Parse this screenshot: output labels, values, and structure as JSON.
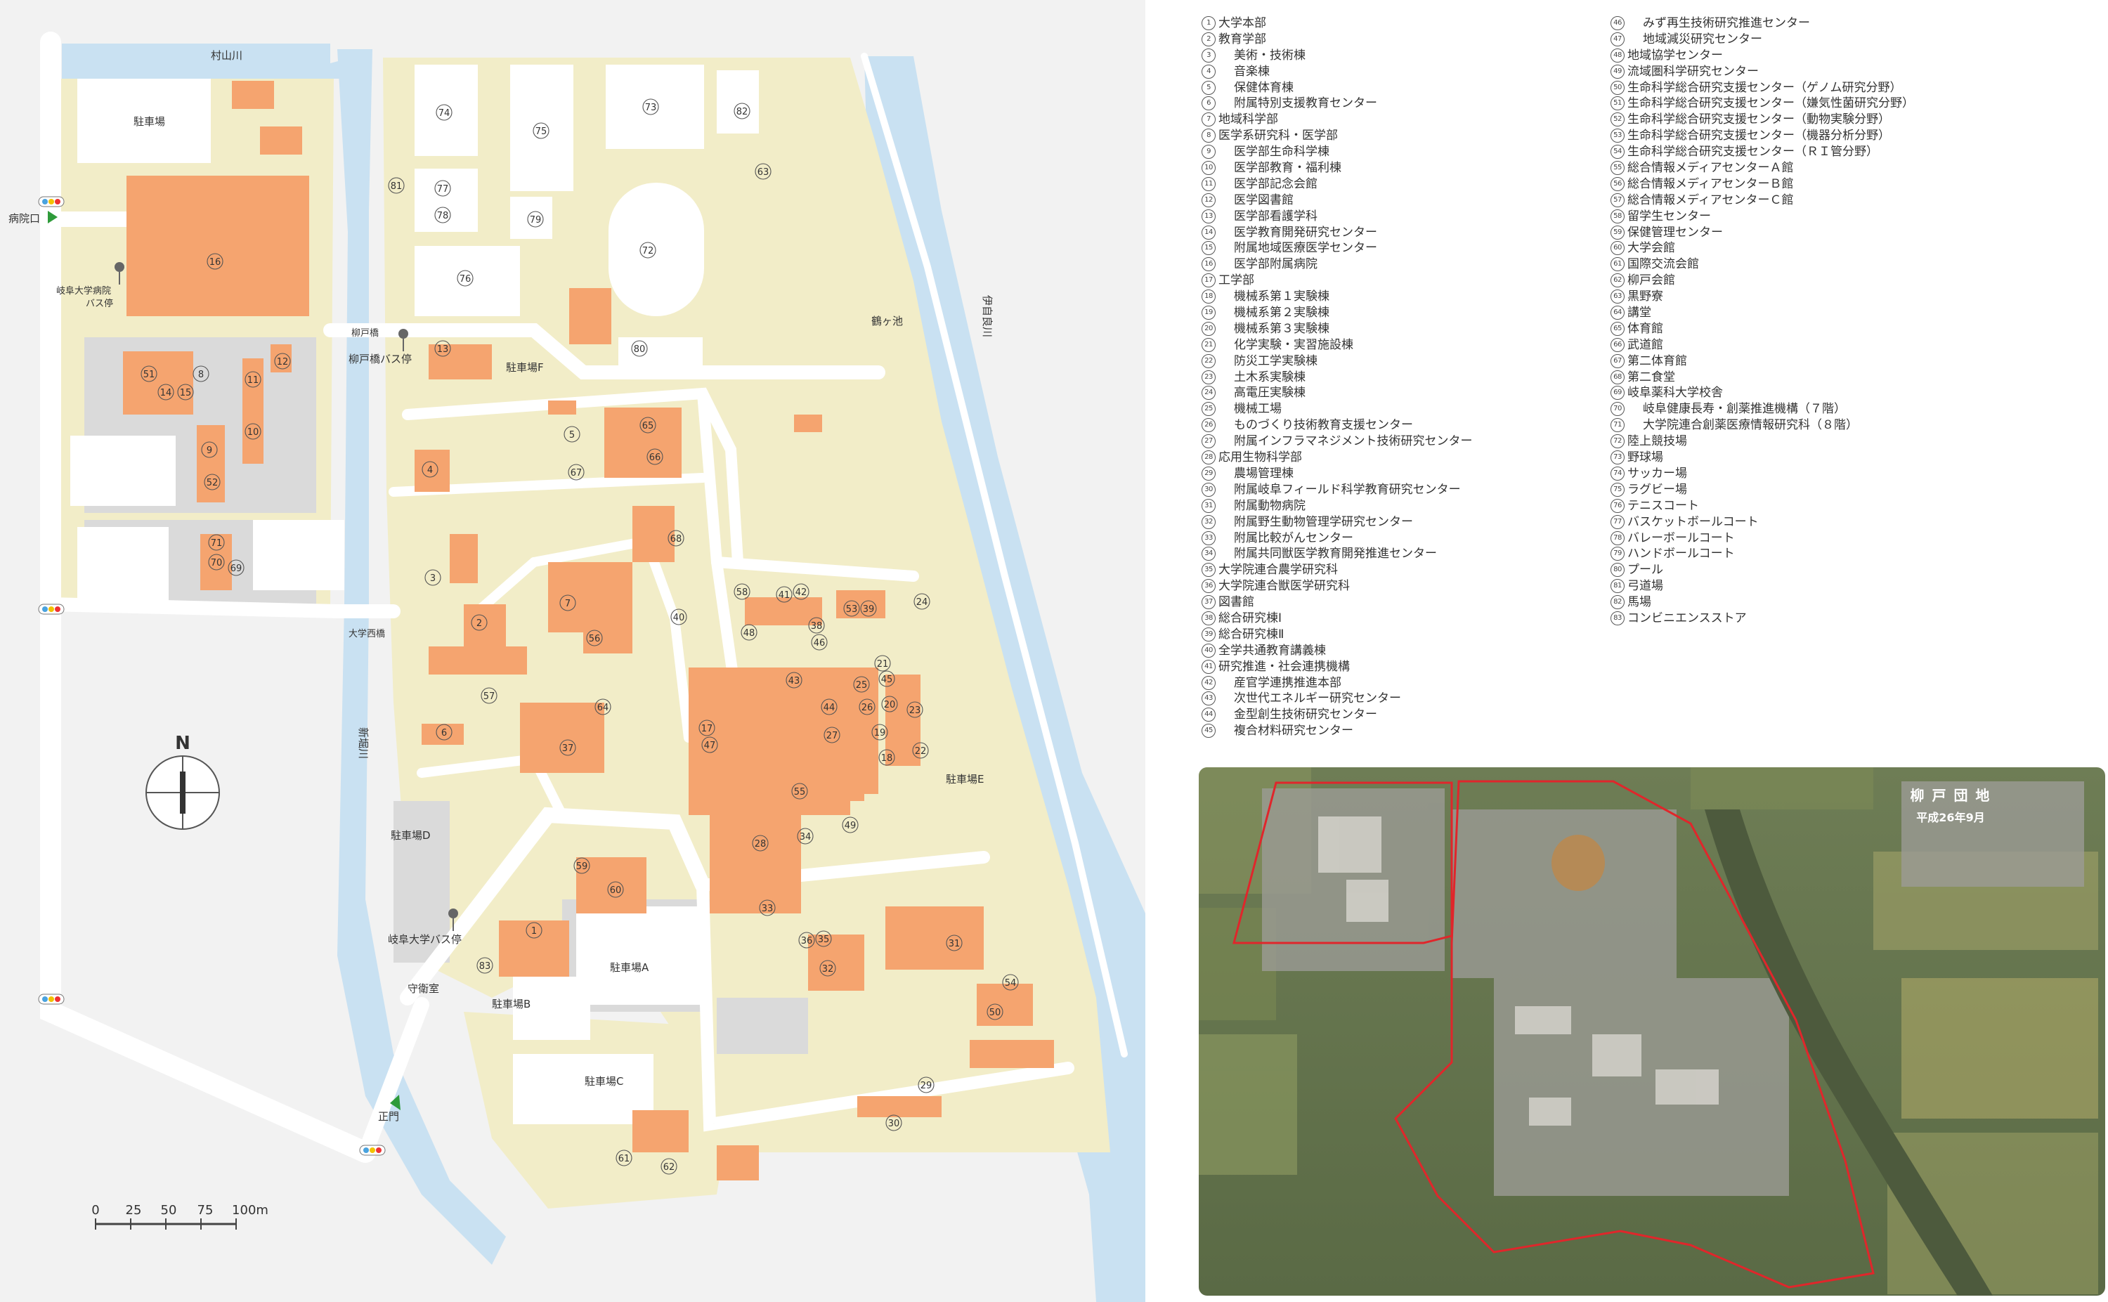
{
  "map": {
    "labels": {
      "murayama_river": "村山川",
      "parking_top": "駐車場",
      "hospital_gate": "病院口",
      "hospital_bus": "岐阜大学病院\nバス停",
      "yanagido_bridge": "柳戸橋",
      "yanagido_bus": "柳戸橋バス停",
      "parking_f": "駐車場F",
      "kakugaike": "鶴ヶ池",
      "ibi_river": "伊自良川",
      "west_bridge": "大学西橋",
      "shinbori_river": "新堀川",
      "parking_d": "駐車場D",
      "parking_e": "駐車場E",
      "gifu_univ_bus": "岐阜大学バス停",
      "guard_room": "守衛室",
      "parking_a": "駐車場A",
      "parking_b": "駐車場B",
      "parking_c": "駐車場C",
      "main_gate": "正門",
      "north": "N",
      "scale_ticks": [
        "0",
        "25",
        "50",
        "75",
        "100m"
      ]
    },
    "colors": {
      "campus": "#f2edc8",
      "building": "#f5a46f",
      "water": "#c9e1f2",
      "road": "#ffffff",
      "grey_block": "#dadada",
      "background": "#f2f2f2"
    }
  },
  "legend": {
    "col1": [
      {
        "n": "1",
        "name": "大学本部",
        "indent": false
      },
      {
        "n": "2",
        "name": "教育学部",
        "indent": false
      },
      {
        "n": "3",
        "name": "美術・技術棟",
        "indent": true
      },
      {
        "n": "4",
        "name": "音楽棟",
        "indent": true
      },
      {
        "n": "5",
        "name": "保健体育棟",
        "indent": true
      },
      {
        "n": "6",
        "name": "附属特別支援教育センター",
        "indent": true
      },
      {
        "n": "7",
        "name": "地域科学部",
        "indent": false
      },
      {
        "n": "8",
        "name": "医学系研究科・医学部",
        "indent": false
      },
      {
        "n": "9",
        "name": "医学部生命科学棟",
        "indent": true
      },
      {
        "n": "10",
        "name": "医学部教育・福利棟",
        "indent": true
      },
      {
        "n": "11",
        "name": "医学部記念会館",
        "indent": true
      },
      {
        "n": "12",
        "name": "医学図書館",
        "indent": true
      },
      {
        "n": "13",
        "name": "医学部看護学科",
        "indent": true
      },
      {
        "n": "14",
        "name": "医学教育開発研究センター",
        "indent": true
      },
      {
        "n": "15",
        "name": "附属地域医療医学センター",
        "indent": true
      },
      {
        "n": "16",
        "name": "医学部附属病院",
        "indent": true
      },
      {
        "n": "17",
        "name": "工学部",
        "indent": false
      },
      {
        "n": "18",
        "name": "機械系第１実験棟",
        "indent": true
      },
      {
        "n": "19",
        "name": "機械系第２実験棟",
        "indent": true
      },
      {
        "n": "20",
        "name": "機械系第３実験棟",
        "indent": true
      },
      {
        "n": "21",
        "name": "化学実験・実習施設棟",
        "indent": true
      },
      {
        "n": "22",
        "name": "防災工学実験棟",
        "indent": true
      },
      {
        "n": "23",
        "name": "土木系実験棟",
        "indent": true
      },
      {
        "n": "24",
        "name": "高電圧実験棟",
        "indent": true
      },
      {
        "n": "25",
        "name": "機械工場",
        "indent": true
      },
      {
        "n": "26",
        "name": "ものづくり技術教育支援センター",
        "indent": true
      },
      {
        "n": "27",
        "name": "附属インフラマネジメント技術研究センター",
        "indent": true
      },
      {
        "n": "28",
        "name": "応用生物科学部",
        "indent": false
      },
      {
        "n": "29",
        "name": "農場管理棟",
        "indent": true
      },
      {
        "n": "30",
        "name": "附属岐阜フィールド科学教育研究センター",
        "indent": true
      },
      {
        "n": "31",
        "name": "附属動物病院",
        "indent": true
      },
      {
        "n": "32",
        "name": "附属野生動物管理学研究センター",
        "indent": true
      },
      {
        "n": "33",
        "name": "附属比較がんセンター",
        "indent": true
      },
      {
        "n": "34",
        "name": "附属共同獣医学教育開発推進センター",
        "indent": true
      },
      {
        "n": "35",
        "name": "大学院連合農学研究科",
        "indent": false
      },
      {
        "n": "36",
        "name": "大学院連合獣医学研究科",
        "indent": false
      },
      {
        "n": "37",
        "name": "図書館",
        "indent": false
      },
      {
        "n": "38",
        "name": "総合研究棟Ⅰ",
        "indent": false
      },
      {
        "n": "39",
        "name": "総合研究棟Ⅱ",
        "indent": false
      },
      {
        "n": "40",
        "name": "全学共通教育講義棟",
        "indent": false
      },
      {
        "n": "41",
        "name": "研究推進・社会連携機構",
        "indent": false
      },
      {
        "n": "42",
        "name": "産官学連携推進本部",
        "indent": true
      },
      {
        "n": "43",
        "name": "次世代エネルギー研究センター",
        "indent": true
      },
      {
        "n": "44",
        "name": "金型創生技術研究センター",
        "indent": true
      },
      {
        "n": "45",
        "name": "複合材料研究センター",
        "indent": true
      }
    ],
    "col2": [
      {
        "n": "46",
        "name": "みず再生技術研究推進センター",
        "indent": true
      },
      {
        "n": "47",
        "name": "地域減災研究センター",
        "indent": true
      },
      {
        "n": "48",
        "name": "地域協学センター",
        "indent": false
      },
      {
        "n": "49",
        "name": "流域圏科学研究センター",
        "indent": false
      },
      {
        "n": "50",
        "name": "生命科学総合研究支援センター（ゲノム研究分野）",
        "indent": false
      },
      {
        "n": "51",
        "name": "生命科学総合研究支援センター（嫌気性菌研究分野）",
        "indent": false
      },
      {
        "n": "52",
        "name": "生命科学総合研究支援センター（動物実験分野）",
        "indent": false
      },
      {
        "n": "53",
        "name": "生命科学総合研究支援センター（機器分析分野）",
        "indent": false
      },
      {
        "n": "54",
        "name": "生命科学総合研究支援センター（ＲＩ管分野）",
        "indent": false
      },
      {
        "n": "55",
        "name": "総合情報メディアセンターＡ館",
        "indent": false
      },
      {
        "n": "56",
        "name": "総合情報メディアセンターＢ館",
        "indent": false
      },
      {
        "n": "57",
        "name": "総合情報メディアセンターＣ館",
        "indent": false
      },
      {
        "n": "58",
        "name": "留学生センター",
        "indent": false
      },
      {
        "n": "59",
        "name": "保健管理センター",
        "indent": false
      },
      {
        "n": "60",
        "name": "大学会館",
        "indent": false
      },
      {
        "n": "61",
        "name": "国際交流会館",
        "indent": false
      },
      {
        "n": "62",
        "name": "柳戸会館",
        "indent": false
      },
      {
        "n": "63",
        "name": "黒野寮",
        "indent": false
      },
      {
        "n": "64",
        "name": "講堂",
        "indent": false
      },
      {
        "n": "65",
        "name": "体育館",
        "indent": false
      },
      {
        "n": "66",
        "name": "武道館",
        "indent": false
      },
      {
        "n": "67",
        "name": "第二体育館",
        "indent": false
      },
      {
        "n": "68",
        "name": "第二食堂",
        "indent": false
      },
      {
        "n": "69",
        "name": "岐阜薬科大学校舎",
        "indent": false
      },
      {
        "n": "70",
        "name": "岐阜健康長寿・創薬推進機構（７階）",
        "indent": true
      },
      {
        "n": "71",
        "name": "大学院連合創薬医療情報研究科（８階）",
        "indent": true
      },
      {
        "n": "72",
        "name": "陸上競技場",
        "indent": false
      },
      {
        "n": "73",
        "name": "野球場",
        "indent": false
      },
      {
        "n": "74",
        "name": "サッカー場",
        "indent": false
      },
      {
        "n": "75",
        "name": "ラグビー場",
        "indent": false
      },
      {
        "n": "76",
        "name": "テニスコート",
        "indent": false
      },
      {
        "n": "77",
        "name": "バスケットボールコート",
        "indent": false
      },
      {
        "n": "78",
        "name": "バレーボールコート",
        "indent": false
      },
      {
        "n": "79",
        "name": "ハンドボールコート",
        "indent": false
      },
      {
        "n": "80",
        "name": "プール",
        "indent": false
      },
      {
        "n": "81",
        "name": "弓道場",
        "indent": false
      },
      {
        "n": "82",
        "name": "馬場",
        "indent": false
      },
      {
        "n": "83",
        "name": "コンビニエンスストア",
        "indent": false
      }
    ]
  },
  "aerial": {
    "title": "柳 戸 団 地",
    "date": "平成26年9月",
    "boundary_color": "#e0262b"
  }
}
